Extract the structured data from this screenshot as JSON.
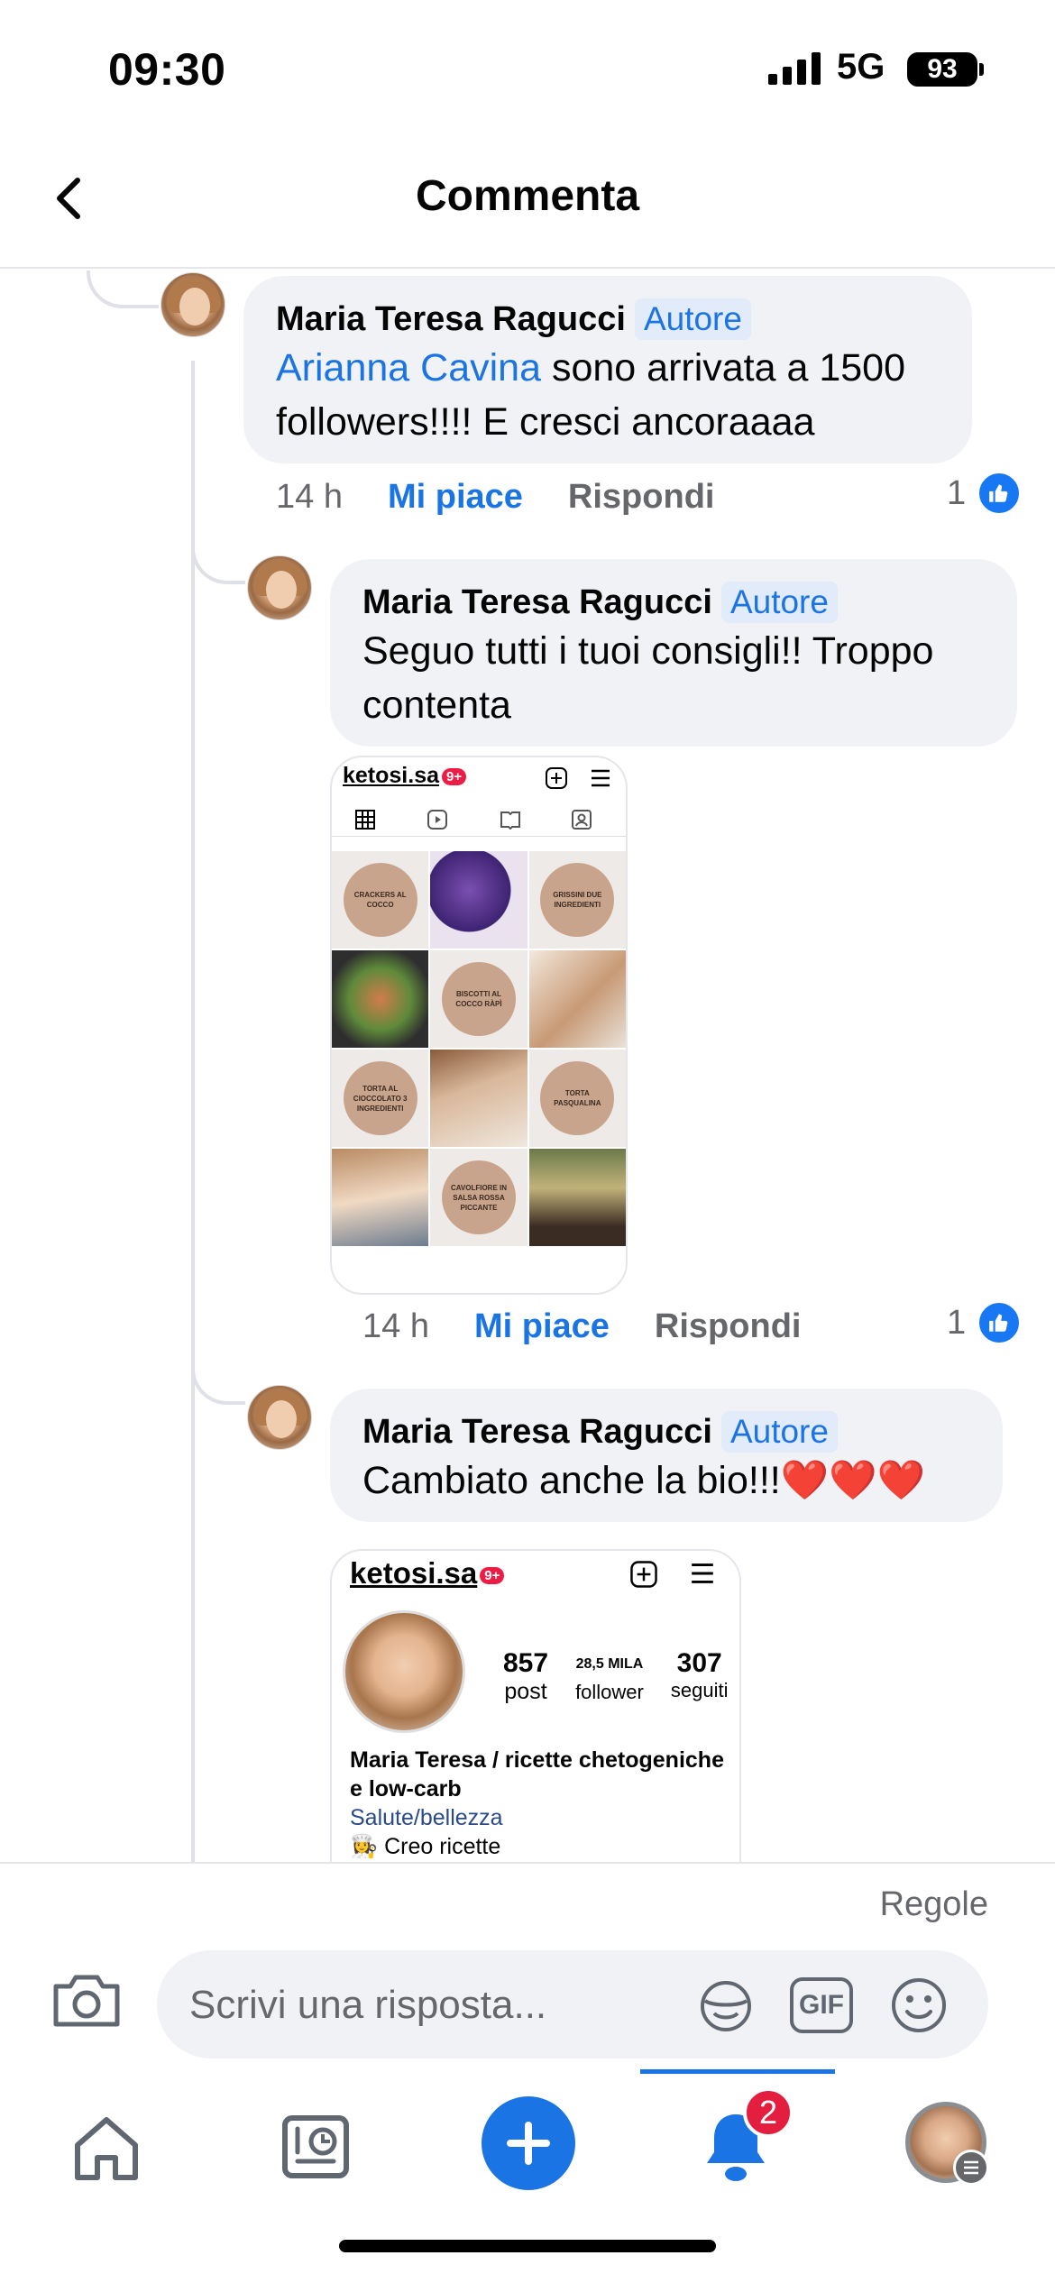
{
  "status_bar": {
    "time": "09:30",
    "network": "5G",
    "battery": "93"
  },
  "header": {
    "title": "Commenta"
  },
  "comments": [
    {
      "author": "Maria Teresa Ragucci",
      "badge": "Autore",
      "mention": "Arianna Cavina",
      "text": " sono arrivata a 1500 followers!!!! E cresci ancoraaaa",
      "time": "14 h",
      "like_label": "Mi piace",
      "reply_label": "Rispondi",
      "reaction_count": "1"
    },
    {
      "author": "Maria Teresa Ragucci",
      "badge": "Autore",
      "text": "Seguo tutti i tuoi consigli!! Troppo contenta",
      "time": "14 h",
      "like_label": "Mi piace",
      "reply_label": "Rispondi",
      "reaction_count": "1",
      "attachment": {
        "handle": "ketosi.sa",
        "notif": "9+",
        "tiles": [
          {
            "type": "text",
            "label": "CRACKERS AL COCCO"
          },
          {
            "type": "photo"
          },
          {
            "type": "text",
            "label": "GRISSINI DUE INGREDIENTI"
          },
          {
            "type": "photo"
          },
          {
            "type": "text",
            "label": "BISCOTTI AL COCCO RÀPÌ"
          },
          {
            "type": "photo"
          },
          {
            "type": "text",
            "label": "TORTA AL CIOCCOLATO 3 INGREDIENTI"
          },
          {
            "type": "photo"
          },
          {
            "type": "text",
            "label": "TORTA PASQUALINA"
          },
          {
            "type": "photo"
          },
          {
            "type": "text",
            "label": "CAVOLFIORE IN SALSA ROSSA PICCANTE"
          },
          {
            "type": "photo"
          }
        ]
      }
    },
    {
      "author": "Maria Teresa Ragucci",
      "badge": "Autore",
      "text": "Cambiato anche la bio!!!❤️❤️❤️",
      "attachment": {
        "handle": "ketosi.sa",
        "notif": "9+",
        "posts_count": "857",
        "posts_label": "post",
        "followers_count": "28,5 MILA",
        "followers_label": "follower",
        "following_count": "307",
        "following_label": "seguiti",
        "bio_name": "Maria Teresa / ricette chetogeniche e low-carb",
        "bio_category": "Salute/bellezza",
        "bio_line": "👩‍🍳 Creo ricette"
      }
    }
  ],
  "composer": {
    "rules_label": "Regole",
    "placeholder": "Scrivi una risposta...",
    "gif_label": "GIF"
  },
  "tabbar": {
    "notifications_badge": "2"
  },
  "colors": {
    "accent": "#1b74e4",
    "bubble": "#f0f2f5",
    "badge_bg": "#e2ebf9",
    "notif": "#e41e3f"
  }
}
